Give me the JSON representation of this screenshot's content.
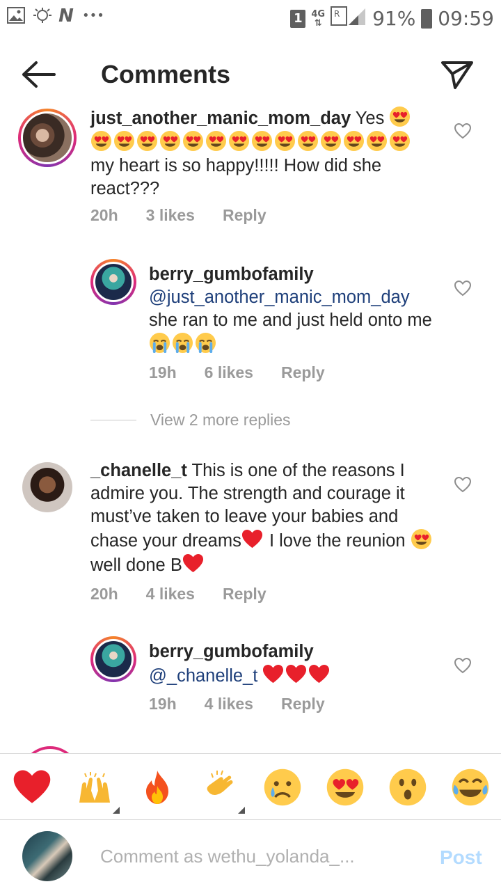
{
  "status_bar": {
    "sim_slot": "1",
    "network": "4G",
    "roaming": "R",
    "battery": "91%",
    "time": "09:59"
  },
  "header": {
    "title": "Comments"
  },
  "comments": [
    {
      "username": "just_another_manic_mom_day",
      "text_before": "Yes",
      "text_after": "my heart is so happy!!!!! How did she react???",
      "time": "20h",
      "likes": "3 likes",
      "reply": "Reply"
    },
    {
      "username": "berry_gumbofamily",
      "mention": "@just_another_manic_mom_day",
      "text": "she ran to me and just held onto me",
      "time": "19h",
      "likes": "6 likes",
      "reply": "Reply"
    },
    {
      "username": "_chanelle_t",
      "text1": "This is one of the reasons I admire you. The strength and courage it must’ve taken to leave your babies and chase your dreams",
      "text2": "I love the reunion",
      "text3": "well done B",
      "time": "20h",
      "likes": "4 likes",
      "reply": "Reply"
    },
    {
      "username": "berry_gumbofamily",
      "mention": "@_chanelle_t",
      "time": "19h",
      "likes": "4 likes",
      "reply": "Reply"
    }
  ],
  "view_more": "View 2 more replies",
  "reactions": [
    "red-heart",
    "raising-hands",
    "fire",
    "clapping-hands",
    "crying-face",
    "heart-eyes",
    "astonished-face",
    "tears-of-joy"
  ],
  "input": {
    "placeholder": "Comment as wethu_yolanda_...",
    "post_label": "Post"
  },
  "colors": {
    "mention": "#1e3f7a",
    "post_disabled": "#b3dbff",
    "meta": "#9a9a9a"
  }
}
